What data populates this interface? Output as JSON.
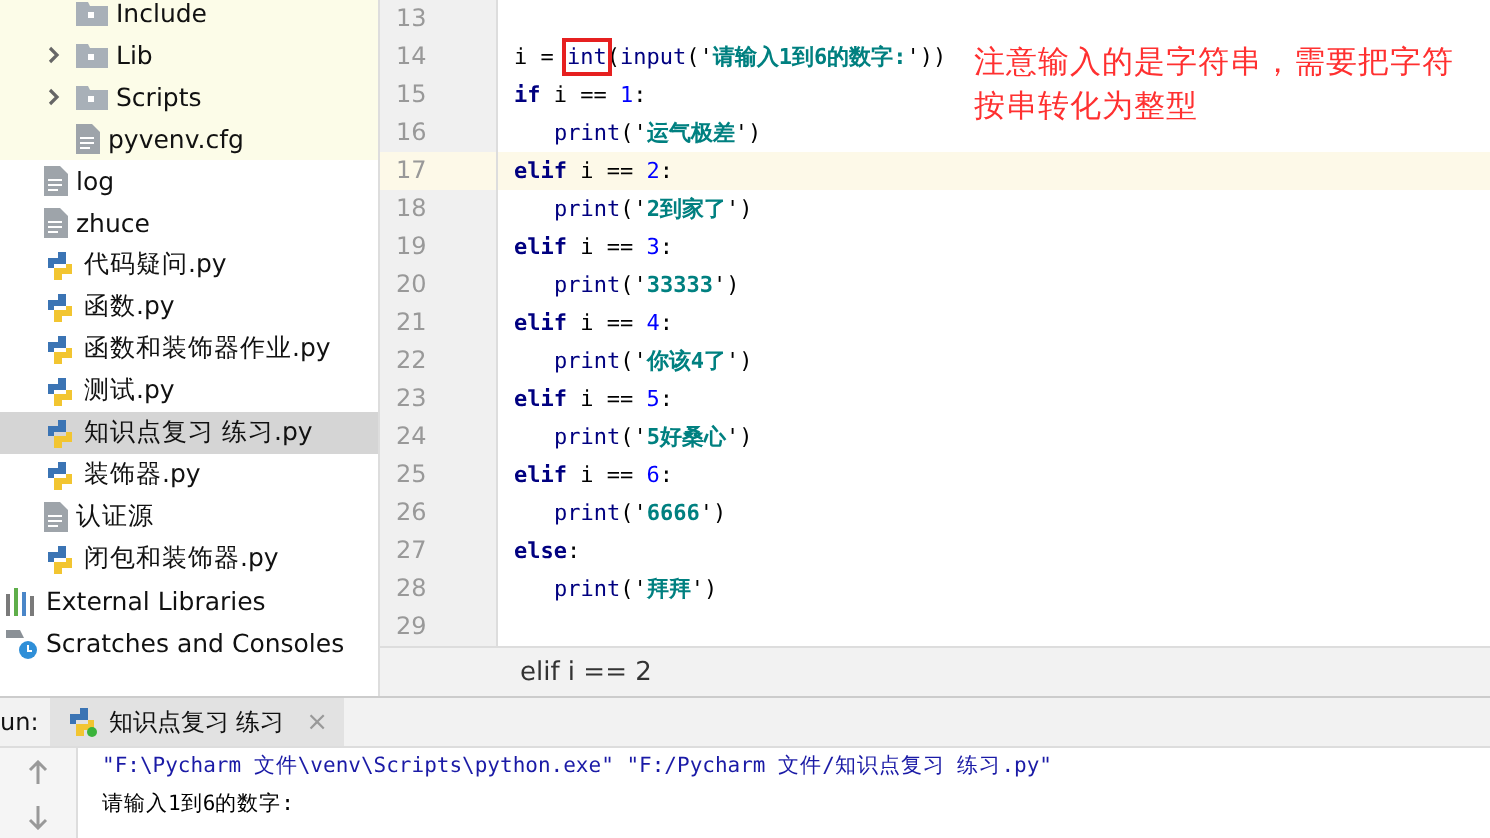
{
  "project_tree": {
    "venv_contents": [
      {
        "label": "Include",
        "kind": "folder",
        "expandable": false
      },
      {
        "label": "Lib",
        "kind": "folder",
        "expandable": true
      },
      {
        "label": "Scripts",
        "kind": "folder",
        "expandable": true
      },
      {
        "label": "pyvenv.cfg",
        "kind": "file",
        "expandable": false
      }
    ],
    "project_files": [
      {
        "label": "log",
        "kind": "file",
        "selected": false
      },
      {
        "label": "zhuce",
        "kind": "file",
        "selected": false
      },
      {
        "label": "代码疑问.py",
        "kind": "python",
        "selected": false
      },
      {
        "label": "函数.py",
        "kind": "python",
        "selected": false
      },
      {
        "label": "函数和装饰器作业.py",
        "kind": "python",
        "selected": false
      },
      {
        "label": "测试.py",
        "kind": "python",
        "selected": false
      },
      {
        "label": "知识点复习 练习.py",
        "kind": "python",
        "selected": true
      },
      {
        "label": "装饰器.py",
        "kind": "python",
        "selected": false
      },
      {
        "label": "认证源",
        "kind": "file",
        "selected": false
      },
      {
        "label": "闭包和装饰器.py",
        "kind": "python",
        "selected": false
      }
    ],
    "root_items": [
      {
        "label": "External Libraries",
        "kind": "libraries"
      },
      {
        "label": "Scratches and Consoles",
        "kind": "scratches"
      }
    ]
  },
  "editor": {
    "lines": [
      {
        "number": "13",
        "current": false,
        "indented": false
      },
      {
        "number": "14",
        "current": false,
        "indented": false,
        "tokens": [
          {
            "text": "i = ",
            "kind": "plain"
          },
          {
            "text": "int",
            "kind": "builtin",
            "boxed": true
          },
          {
            "text": "(",
            "kind": "plain"
          },
          {
            "text": "input",
            "kind": "builtin"
          },
          {
            "text": "('",
            "kind": "plain"
          },
          {
            "text": "请输入1到6的数字:",
            "kind": "string"
          },
          {
            "text": "'))",
            "kind": "plain"
          }
        ]
      },
      {
        "number": "15",
        "current": false,
        "indented": false,
        "tokens": [
          {
            "text": "if",
            "kind": "keyword"
          },
          {
            "text": " i == ",
            "kind": "plain"
          },
          {
            "text": "1",
            "kind": "number"
          },
          {
            "text": ":",
            "kind": "plain"
          }
        ]
      },
      {
        "number": "16",
        "current": false,
        "indented": true,
        "tokens": [
          {
            "text": "print",
            "kind": "builtin"
          },
          {
            "text": "('",
            "kind": "plain"
          },
          {
            "text": "运气极差",
            "kind": "string"
          },
          {
            "text": "')",
            "kind": "plain"
          }
        ]
      },
      {
        "number": "17",
        "current": true,
        "indented": false,
        "tokens": [
          {
            "text": "elif",
            "kind": "keyword"
          },
          {
            "text": " i == ",
            "kind": "plain"
          },
          {
            "text": "2",
            "kind": "number"
          },
          {
            "text": ":",
            "kind": "plain"
          }
        ]
      },
      {
        "number": "18",
        "current": false,
        "indented": true,
        "tokens": [
          {
            "text": "print",
            "kind": "builtin"
          },
          {
            "text": "('",
            "kind": "plain"
          },
          {
            "text": "2到家了",
            "kind": "string"
          },
          {
            "text": "')",
            "kind": "plain"
          }
        ]
      },
      {
        "number": "19",
        "current": false,
        "indented": false,
        "tokens": [
          {
            "text": "elif",
            "kind": "keyword"
          },
          {
            "text": " i == ",
            "kind": "plain"
          },
          {
            "text": "3",
            "kind": "number"
          },
          {
            "text": ":",
            "kind": "plain"
          }
        ]
      },
      {
        "number": "20",
        "current": false,
        "indented": true,
        "tokens": [
          {
            "text": "print",
            "kind": "builtin"
          },
          {
            "text": "('",
            "kind": "plain"
          },
          {
            "text": "33333",
            "kind": "string"
          },
          {
            "text": "')",
            "kind": "plain"
          }
        ]
      },
      {
        "number": "21",
        "current": false,
        "indented": false,
        "tokens": [
          {
            "text": "elif",
            "kind": "keyword"
          },
          {
            "text": " i == ",
            "kind": "plain"
          },
          {
            "text": "4",
            "kind": "number"
          },
          {
            "text": ":",
            "kind": "plain"
          }
        ]
      },
      {
        "number": "22",
        "current": false,
        "indented": true,
        "tokens": [
          {
            "text": "print",
            "kind": "builtin"
          },
          {
            "text": "('",
            "kind": "plain"
          },
          {
            "text": "你该4了",
            "kind": "string"
          },
          {
            "text": "')",
            "kind": "plain"
          }
        ]
      },
      {
        "number": "23",
        "current": false,
        "indented": false,
        "tokens": [
          {
            "text": "elif",
            "kind": "keyword"
          },
          {
            "text": " i == ",
            "kind": "plain"
          },
          {
            "text": "5",
            "kind": "number"
          },
          {
            "text": ":",
            "kind": "plain"
          }
        ]
      },
      {
        "number": "24",
        "current": false,
        "indented": true,
        "tokens": [
          {
            "text": "print",
            "kind": "builtin"
          },
          {
            "text": "('",
            "kind": "plain"
          },
          {
            "text": "5好桑心",
            "kind": "string"
          },
          {
            "text": "')",
            "kind": "plain"
          }
        ]
      },
      {
        "number": "25",
        "current": false,
        "indented": false,
        "tokens": [
          {
            "text": "elif",
            "kind": "keyword"
          },
          {
            "text": " i == ",
            "kind": "plain"
          },
          {
            "text": "6",
            "kind": "number"
          },
          {
            "text": ":",
            "kind": "plain"
          }
        ]
      },
      {
        "number": "26",
        "current": false,
        "indented": true,
        "tokens": [
          {
            "text": "print",
            "kind": "builtin"
          },
          {
            "text": "('",
            "kind": "plain"
          },
          {
            "text": "6666",
            "kind": "string"
          },
          {
            "text": "')",
            "kind": "plain"
          }
        ]
      },
      {
        "number": "27",
        "current": false,
        "indented": false,
        "tokens": [
          {
            "text": "else",
            "kind": "keyword"
          },
          {
            "text": ":",
            "kind": "plain"
          }
        ]
      },
      {
        "number": "28",
        "current": false,
        "indented": true,
        "tokens": [
          {
            "text": "print",
            "kind": "builtin"
          },
          {
            "text": "('",
            "kind": "plain"
          },
          {
            "text": "拜拜",
            "kind": "string"
          },
          {
            "text": "')",
            "kind": "plain"
          }
        ]
      },
      {
        "number": "29",
        "current": false,
        "indented": false
      }
    ],
    "note": [
      "注意输入的是字符串，需要把字符",
      "按串转化为整型"
    ],
    "breadcrumb": "elif i == 2"
  },
  "run_panel": {
    "label": "un:",
    "tab": "知识点复习 练习",
    "close": "×",
    "console": [
      {
        "text": "\"F:\\Pycharm 文件\\venv\\Scripts\\python.exe\" \"F:/Pycharm 文件/知识点复习 练习.py\"",
        "kind": "command"
      },
      {
        "text": "请输入1到6的数字:",
        "kind": "output"
      }
    ]
  }
}
